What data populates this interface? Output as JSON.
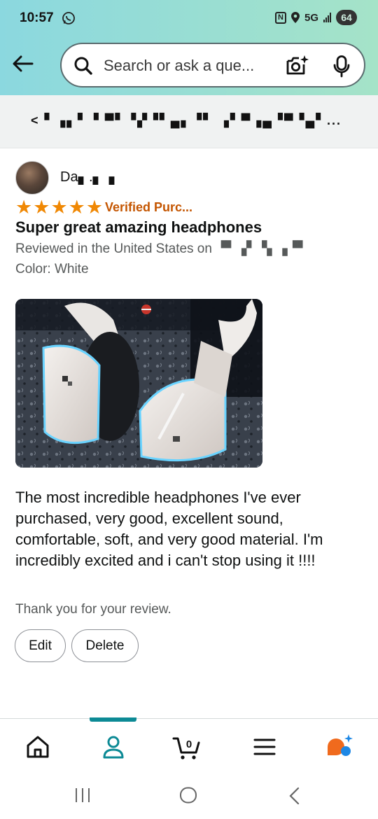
{
  "status_bar": {
    "time": "10:57",
    "network": "5G",
    "battery": "64"
  },
  "search": {
    "placeholder": "Search or ask a que..."
  },
  "breadcrumb": {
    "text": "< ▘▗▖▘▝ ▀▘▝▞▝▘▄▖▝▘ ▗▘▀▗▄▝▀▝▄▘..."
  },
  "review": {
    "author": "Da▖.▖▗",
    "rating": 5,
    "rating_max": 5,
    "verified": "Verified Purc...",
    "title": "Super great amazing headphones",
    "reviewed_in": "Reviewed in the United States on ▝▘▗▘▝▖▗▝▘",
    "color": "Color: White",
    "body": "The most incredible headphones I've ever purchased, very good, excellent sound, comfortable, soft, and very good material. I'm incredibly excited and i can't stop using it !!!!",
    "thanks": "Thank you for your review.",
    "edit_label": "Edit",
    "delete_label": "Delete"
  },
  "bottom_nav": {
    "items": [
      "home-icon",
      "account-icon",
      "cart-icon",
      "menu-icon",
      "rufus-assistant-icon"
    ],
    "active_index": 1,
    "cart_count": "0"
  },
  "colors": {
    "accent": "#0c8a95",
    "star": "#f08804",
    "verified": "#c45500"
  }
}
